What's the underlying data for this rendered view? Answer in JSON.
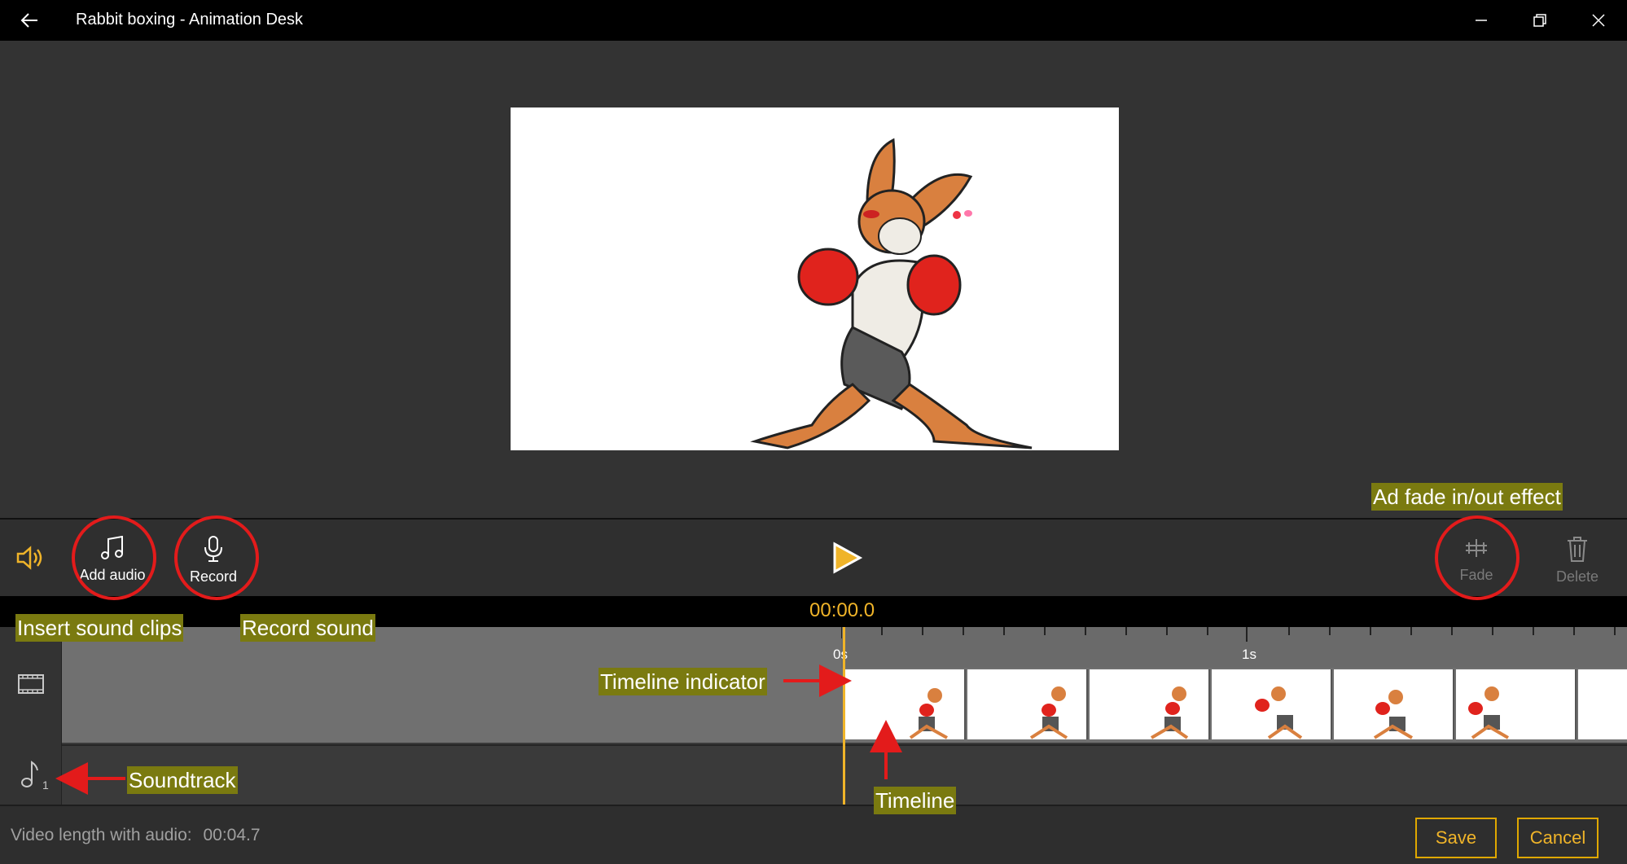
{
  "window": {
    "title": "Rabbit boxing - Animation Desk"
  },
  "toolbar": {
    "add_audio_label": "Add audio",
    "record_label": "Record",
    "fade_label": "Fade",
    "delete_label": "Delete"
  },
  "timecode": "00:00.0",
  "ruler": {
    "tick_0": "0s",
    "tick_1": "1s"
  },
  "footer": {
    "video_length_label": "Video length with audio:",
    "video_length_value": "00:04.7",
    "save_label": "Save",
    "cancel_label": "Cancel"
  },
  "annotations": {
    "insert_sound": "Insert sound clips",
    "record_sound": "Record sound",
    "fade_effect": "Ad fade in/out effect",
    "timeline_indicator": "Timeline indicator",
    "timeline": "Timeline",
    "soundtrack": "Soundtrack"
  },
  "audio_track": {
    "number": "1"
  },
  "colors": {
    "accent": "#f0b429",
    "annotation_bg": "#7a7a10",
    "callout_red": "#e31b1b"
  }
}
